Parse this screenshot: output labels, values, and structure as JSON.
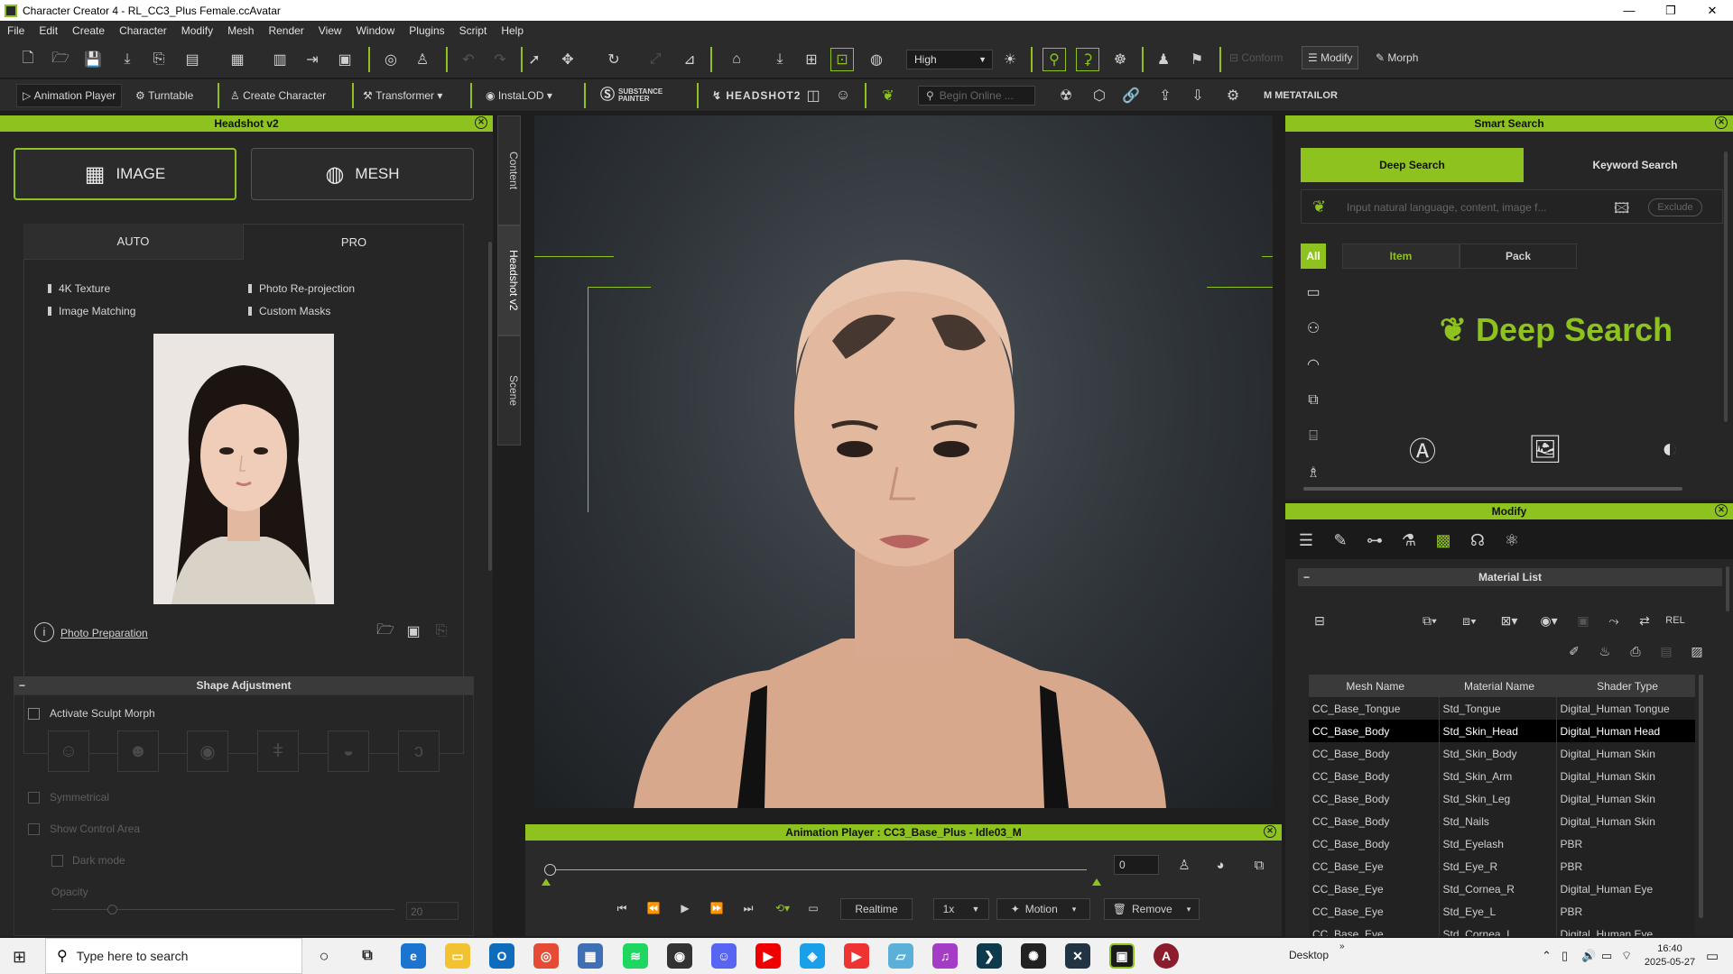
{
  "window": {
    "title": "Character Creator 4 - RL_CC3_Plus Female.ccAvatar",
    "minimize": "—",
    "maximize": "❐",
    "close": "✕"
  },
  "menu": [
    "File",
    "Edit",
    "Create",
    "Character",
    "Modify",
    "Mesh",
    "Render",
    "View",
    "Window",
    "Plugins",
    "Script",
    "Help"
  ],
  "toolbar1": {
    "quality": "High",
    "conform": "Conform",
    "modify": "Modify",
    "morph": "Morph"
  },
  "toolbar2": {
    "animation_player": "Animation Player",
    "turntable": "Turntable",
    "create_character": "Create Character",
    "transformer": "Transformer",
    "instalod": "InstaLOD",
    "substance": "SUBSTANCE PAINTER",
    "headshot2": "HEADSHOT2",
    "search_placeholder": "Begin Online ...",
    "metatailor": "METATAILOR"
  },
  "headshot": {
    "title": "Headshot v2",
    "image_btn": "IMAGE",
    "mesh_btn": "MESH",
    "tab_auto": "AUTO",
    "tab_pro": "PRO",
    "features": [
      "4K Texture",
      "Photo Re-projection",
      "Image Matching",
      "Custom Masks"
    ],
    "photo_prep": "Photo Preparation",
    "shape_adjustment": "Shape Adjustment",
    "activate_sculpt": "Activate Sculpt Morph",
    "symmetrical": "Symmetrical",
    "show_control": "Show Control Area",
    "dark_mode": "Dark mode",
    "opacity": "Opacity",
    "opacity_value": "20"
  },
  "side_tabs": {
    "content": "Content",
    "headshot": "Headshot v2",
    "scene": "Scene"
  },
  "anim": {
    "title": "Animation Player : CC3_Base_Plus - Idle03_M",
    "frame": "0",
    "realtime": "Realtime",
    "speed": "1x",
    "motion": "Motion",
    "remove": "Remove"
  },
  "smart_search": {
    "title": "Smart Search",
    "deep": "Deep Search",
    "keyword": "Keyword Search",
    "placeholder": "Input natural language, content, image f...",
    "exclude": "Exclude",
    "all": "All",
    "item": "Item",
    "pack": "Pack",
    "logo_text": "Deep Search"
  },
  "modify": {
    "title": "Modify",
    "material_list": "Material List"
  },
  "materials": {
    "headers": [
      "Mesh Name",
      "Material Name",
      "Shader Type"
    ],
    "rows": [
      [
        "CC_Base_Tongue",
        "Std_Tongue",
        "Digital_Human Tongue"
      ],
      [
        "CC_Base_Body",
        "Std_Skin_Head",
        "Digital_Human Head"
      ],
      [
        "CC_Base_Body",
        "Std_Skin_Body",
        "Digital_Human Skin"
      ],
      [
        "CC_Base_Body",
        "Std_Skin_Arm",
        "Digital_Human Skin"
      ],
      [
        "CC_Base_Body",
        "Std_Skin_Leg",
        "Digital_Human Skin"
      ],
      [
        "CC_Base_Body",
        "Std_Nails",
        "Digital_Human Skin"
      ],
      [
        "CC_Base_Body",
        "Std_Eyelash",
        "PBR"
      ],
      [
        "CC_Base_Eye",
        "Std_Eye_R",
        "PBR"
      ],
      [
        "CC_Base_Eye",
        "Std_Cornea_R",
        "Digital_Human Eye"
      ],
      [
        "CC_Base_Eye",
        "Std_Eye_L",
        "PBR"
      ],
      [
        "CC_Base_Eye",
        "Std_Cornea_L",
        "Digital_Human Eye"
      ]
    ]
  },
  "taskbar": {
    "search": "Type here to search",
    "desktop": "Desktop",
    "time": "16:40",
    "date": "2025-05-27"
  },
  "colors": {
    "accent": "#8dc21f"
  }
}
